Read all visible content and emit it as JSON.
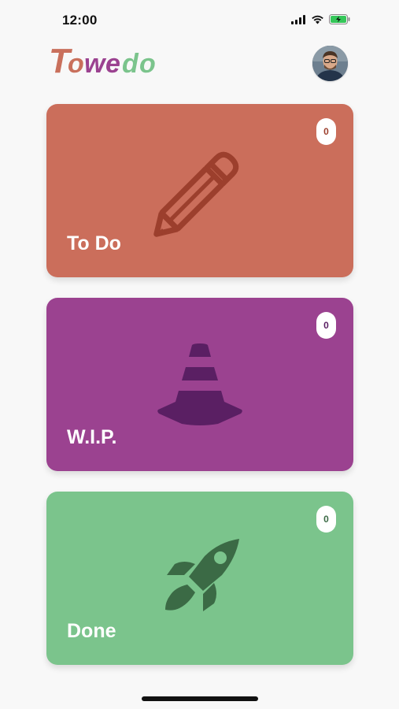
{
  "status_bar": {
    "time": "12:00",
    "icons": [
      "signal-icon",
      "wifi-icon",
      "battery-charging-icon"
    ]
  },
  "header": {
    "logo_text": "Towedo",
    "logo_letters": [
      "T",
      "o",
      "w",
      "e",
      "d",
      "o"
    ],
    "logo_colors": [
      "#c9705c",
      "#c9705c",
      "#9b4290",
      "#9b4290",
      "#7bc48c",
      "#7bc48c"
    ],
    "avatar": "avatar"
  },
  "cards": [
    {
      "id": "todo",
      "label": "To Do",
      "count": "0",
      "color": "#cb6e5b",
      "icon": "pencil-icon",
      "icon_color": "#9c3f2d",
      "badge_text_color": "#9c3f2d"
    },
    {
      "id": "wip",
      "label": "W.I.P.",
      "count": "0",
      "color": "#9b4290",
      "icon": "traffic-cone-icon",
      "icon_color": "#5a1f63",
      "badge_text_color": "#5a1f63"
    },
    {
      "id": "done",
      "label": "Done",
      "count": "0",
      "color": "#7bc48c",
      "icon": "rocket-icon",
      "icon_color": "#3b6a45",
      "badge_text_color": "#3b6a45"
    }
  ]
}
